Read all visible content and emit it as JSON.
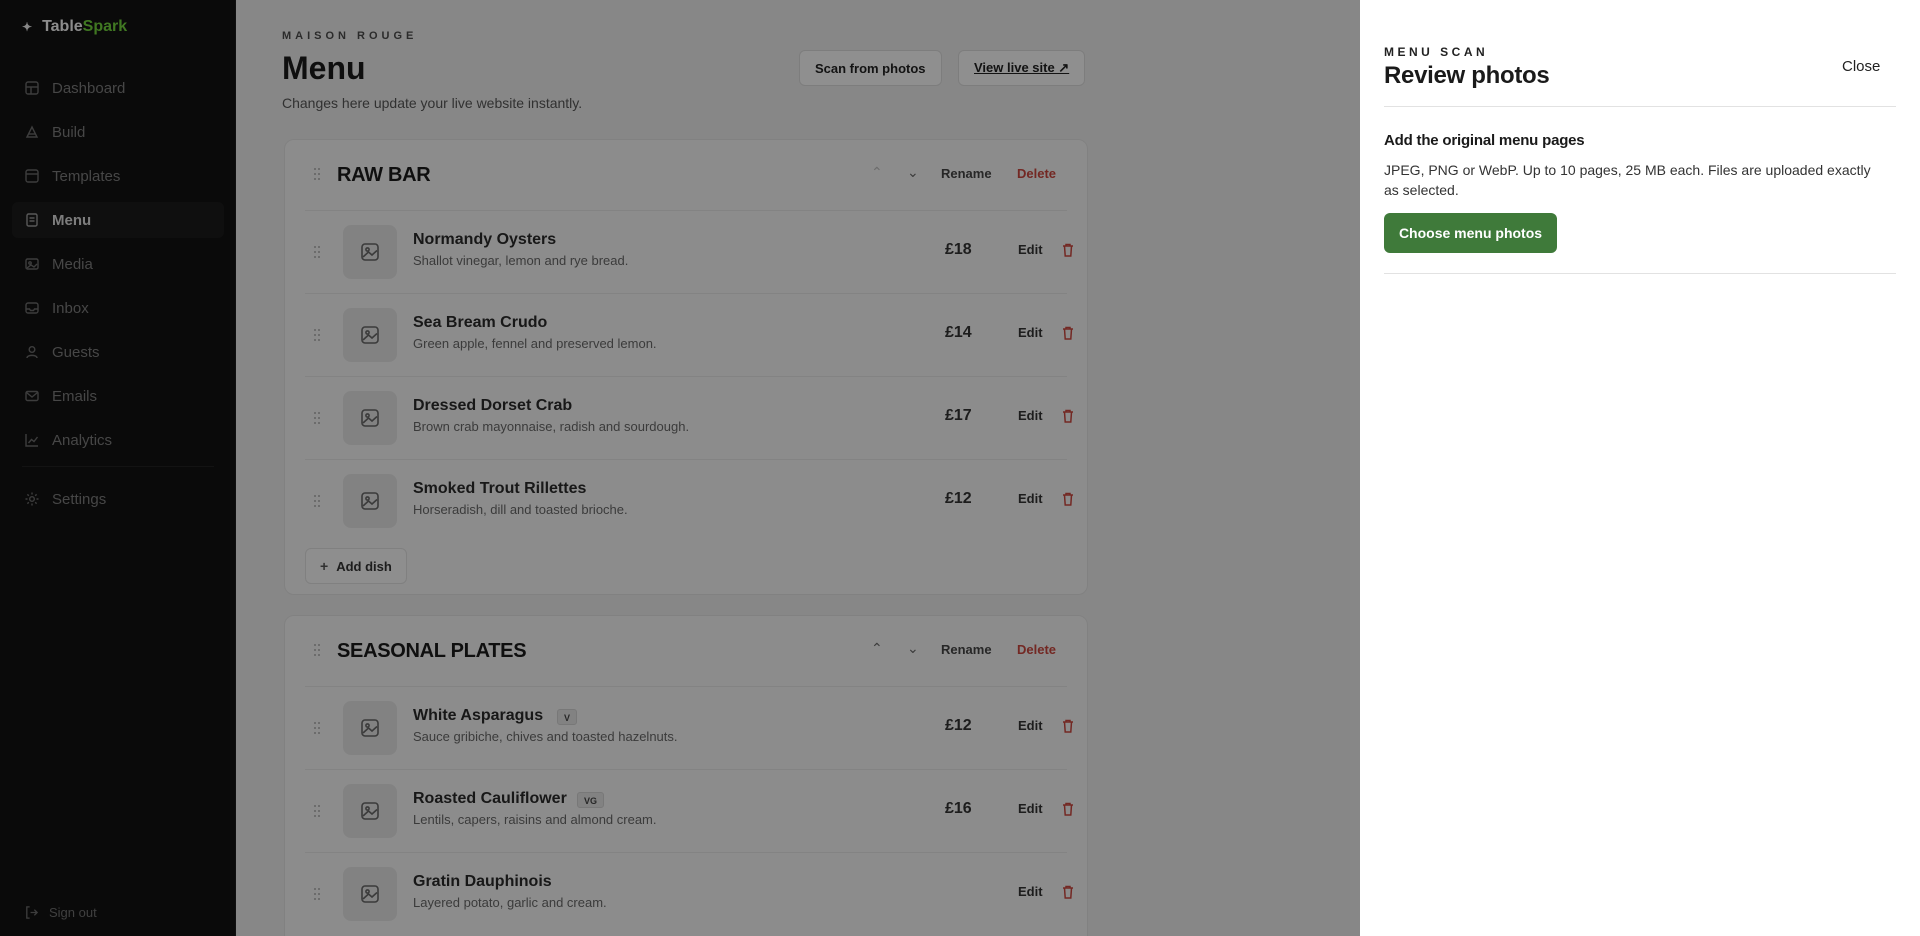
{
  "app": {
    "brand_part1": "Table",
    "brand_part2": "Spark"
  },
  "sidebar": {
    "items": [
      {
        "label": "Dashboard",
        "icon": "grid-icon"
      },
      {
        "label": "Build",
        "icon": "build-icon"
      },
      {
        "label": "Templates",
        "icon": "templates-icon"
      },
      {
        "label": "Menu",
        "icon": "menu-icon",
        "active": true
      },
      {
        "label": "Media",
        "icon": "image-icon"
      },
      {
        "label": "Inbox",
        "icon": "inbox-icon"
      },
      {
        "label": "Guests",
        "icon": "user-icon"
      },
      {
        "label": "Emails",
        "icon": "mail-icon"
      },
      {
        "label": "Analytics",
        "icon": "chart-icon"
      }
    ],
    "settings": "Settings",
    "signout": "Sign out"
  },
  "header": {
    "eyebrow": "MAISON ROUGE",
    "title": "Menu",
    "subtitle": "Changes here update your live website instantly.",
    "scan_button": "Scan from photos",
    "view_button": "View live site ↗"
  },
  "sections": [
    {
      "title": "RAW BAR",
      "up": "⌃",
      "down": "⌄",
      "rename": "Rename",
      "delete": "Delete",
      "add_dish": "Add dish",
      "dishes": [
        {
          "name": "Normandy Oysters",
          "desc": "Shallot vinegar, lemon and rye bread.",
          "price": "£18",
          "edit": "Edit"
        },
        {
          "name": "Sea Bream Crudo",
          "desc": "Green apple, fennel and preserved lemon.",
          "price": "£14",
          "edit": "Edit"
        },
        {
          "name": "Dressed Dorset Crab",
          "desc": "Brown crab mayonnaise, radish and sourdough.",
          "price": "£17",
          "edit": "Edit"
        },
        {
          "name": "Smoked Trout Rillettes",
          "desc": "Horseradish, dill and toasted brioche.",
          "price": "£12",
          "edit": "Edit"
        }
      ]
    },
    {
      "title": "SEASONAL PLATES",
      "up": "⌃",
      "down": "⌄",
      "rename": "Rename",
      "delete": "Delete",
      "dishes": [
        {
          "name": "White Asparagus",
          "badge": "V",
          "desc": "Sauce gribiche, chives and toasted hazelnuts.",
          "price": "£12",
          "edit": "Edit"
        },
        {
          "name": "Roasted Cauliflower",
          "badge": "VG",
          "desc": "Lentils, capers, raisins and almond cream.",
          "price": "£16",
          "edit": "Edit"
        },
        {
          "name": "Gratin Dauphinois",
          "desc": "Layered potato, garlic and cream.",
          "price": "",
          "edit": "Edit"
        }
      ]
    }
  ],
  "drawer": {
    "eyebrow": "MENU SCAN",
    "title": "Review photos",
    "close": "Close",
    "heading": "Add the original menu pages",
    "body": "JPEG, PNG or WebP. Up to 10 pages, 25 MB each. Files are uploaded exactly as selected.",
    "choose_button": "Choose menu photos"
  },
  "colors": {
    "accent_green": "#3f7a3a",
    "brand_green": "#6fcf3b",
    "danger": "#c6453d"
  }
}
